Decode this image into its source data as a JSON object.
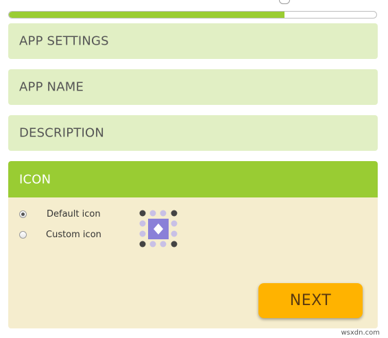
{
  "progress": {
    "value": 0.75,
    "fill_color": "#9acd32"
  },
  "top_icon": "speech-bubble-icon",
  "sections": [
    {
      "title": "APP SETTINGS"
    },
    {
      "title": "APP NAME"
    },
    {
      "title": "DESCRIPTION"
    }
  ],
  "icon_section": {
    "title": "ICON",
    "header_color": "#99cc33",
    "options": [
      {
        "label": "Default icon",
        "checked": true
      },
      {
        "label": "Custom icon",
        "checked": false
      }
    ],
    "preview_icon": "default-app-icon"
  },
  "next_button": {
    "label": "NEXT",
    "color": "#ffb300"
  },
  "watermark": "wsxdn.com"
}
